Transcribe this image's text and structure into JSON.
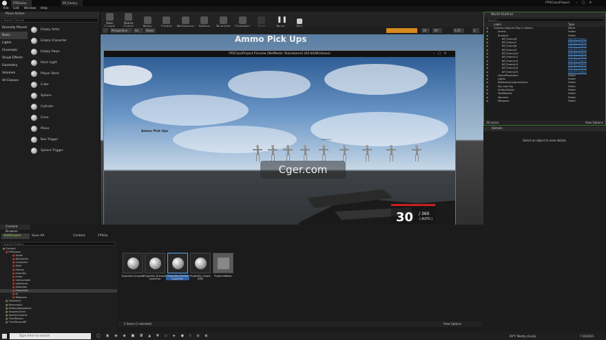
{
  "window": {
    "tab": "FPSGame",
    "tab2": "BP_Enemy",
    "project": "FPSClassProject"
  },
  "menu": [
    "File",
    "Edit",
    "Window",
    "Help"
  ],
  "place_actors": {
    "title": "Place Actors",
    "search_placeholder": "Search Classes",
    "categories": [
      "Recently Placed",
      "Basic",
      "Lights",
      "Cinematic",
      "Visual Effects",
      "Geometry",
      "Volumes",
      "All Classes"
    ],
    "selected": 1,
    "actors": [
      "Empty Actor",
      "Empty Character",
      "Empty Pawn",
      "Point Light",
      "Player Start",
      "Cube",
      "Sphere",
      "Cylinder",
      "Cone",
      "Plane",
      "Box Trigger",
      "Sphere Trigger"
    ]
  },
  "toolbar": [
    "Save Current",
    "Source Control",
    "Modes",
    "Content",
    "Marketplace",
    "Settings",
    "Blueprints",
    "Cinematics",
    "Build",
    "Pause",
    "Stop"
  ],
  "viewport": {
    "perspective": "Perspective",
    "lit": "Lit",
    "show": "Show",
    "grid": "10",
    "angle": "10°",
    "scale": "0.25",
    "cam": "4"
  },
  "pie": {
    "title": "FPSClassProject Preview [NetMode: Standalone] (64-bit/Windows)",
    "sign": "Ammo Pick Ups",
    "label": "Ammo Pick Ups",
    "small_label": "Explosion"
  },
  "hud": {
    "ammo": "30",
    "reserve": "/ 360",
    "mode": "( AUTO )"
  },
  "watermark": "Cger.com",
  "outliner": {
    "title": "World Outliner",
    "search_placeholder": "Search...",
    "col_label": "Label",
    "col_type": "Type",
    "rows": [
      {
        "label": "Untitled_Default (Play In Editor)",
        "type": "World",
        "link": false
      },
      {
        "label": "Ammo",
        "type": "Folder",
        "link": false
      },
      {
        "label": "Enemies",
        "type": "Folder",
        "link": false
      },
      {
        "label": "BP_Enemy6",
        "type": "Edit BP_Enemy",
        "link": true
      },
      {
        "label": "BP_Enemy7",
        "type": "Edit BP_Enemy",
        "link": true
      },
      {
        "label": "BP_Enemy8",
        "type": "Edit BP_Enemy",
        "link": true
      },
      {
        "label": "BP_Enemy9",
        "type": "Edit BP_Enemy",
        "link": true
      },
      {
        "label": "BP_Enemy10",
        "type": "Edit BP_Enemy",
        "link": true
      },
      {
        "label": "BP_Enemy11",
        "type": "Edit BP_Enemy",
        "link": true
      },
      {
        "label": "BP_Enemy12",
        "type": "Edit BP_Enemy",
        "link": true
      },
      {
        "label": "BP_Enemy13",
        "type": "Edit BP_Enemy",
        "link": true
      },
      {
        "label": "BP_Enemy14",
        "type": "Edit BP_Enemy",
        "link": true
      },
      {
        "label": "BP_Enemy15",
        "type": "Edit BP_Enemy",
        "link": true
      },
      {
        "label": "GamePlayActors",
        "type": "Folder",
        "link": false
      },
      {
        "label": "Lights",
        "type": "Folder",
        "link": false
      },
      {
        "label": "ReflectionCaptureActors",
        "type": "Folder",
        "link": false
      },
      {
        "label": "Sky and Fog",
        "type": "Folder",
        "link": false
      },
      {
        "label": "SurfaceTypes",
        "type": "Folder",
        "link": false
      },
      {
        "label": "TestMeshes",
        "type": "Folder",
        "link": false
      },
      {
        "label": "Volumes",
        "type": "Folder",
        "link": false
      },
      {
        "label": "Weapons",
        "type": "Folder",
        "link": false
      }
    ],
    "count": "56 actors",
    "view_options": "View Options"
  },
  "details": {
    "title": "Details",
    "empty": "Select an object to view details."
  },
  "content_browser": {
    "title": "Content Browser",
    "add": "Add/Import",
    "save": "Save All",
    "path": [
      "Content",
      "FPSGa"
    ],
    "filter_placeholder": "Search Folders",
    "tree": [
      "Content",
      "FPSGame",
      "Audio",
      "Blueprints",
      "Character",
      "Data",
      "Effects",
      "Enemies",
      "Fonts",
      "Interactable",
      "Interfaces",
      "Materials",
      "Projectiles",
      "UI",
      "Weapons",
      "Geometry",
      "Mannequin",
      "MilitaryWeapSilver",
      "ShooterGame",
      "StarterContent",
      "ThirdPerson",
      "ThirdPersonBP"
    ],
    "selected_tree": 12,
    "assets": [
      "Explosion Impulse",
      "Projectile_Grenade Launcher",
      "Projectile_Rocket Launcher",
      "Projectile_Sniper Rifle",
      "ProjectileBase"
    ],
    "status": "5 items (1 selected)",
    "view_options": "View Options"
  },
  "taskbar": {
    "search": "Type here to search",
    "weather": "69°F  Mostly cloudy",
    "time": "7:16/2021"
  },
  "accent": "#5aa7ff",
  "hud_red": "#cc1f1f"
}
